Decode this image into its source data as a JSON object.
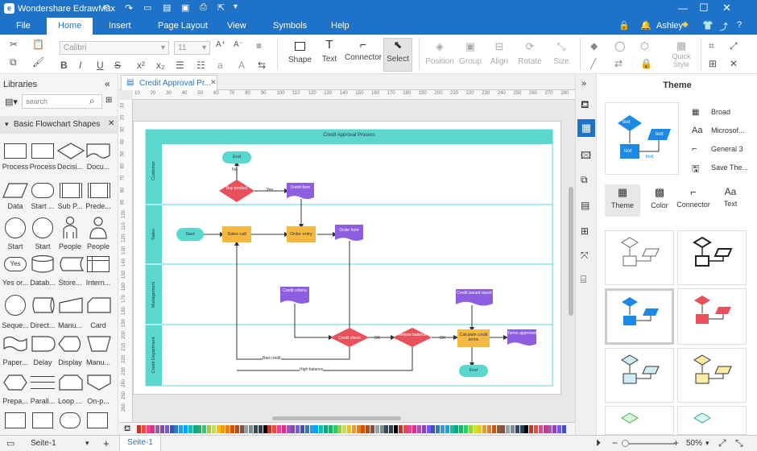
{
  "app": {
    "title": "Wondershare EdrawMax",
    "user": "Ashley"
  },
  "menu": [
    "File",
    "Home",
    "Insert",
    "Page Layout",
    "View",
    "Symbols",
    "Help"
  ],
  "ribbon": {
    "font": "Calibri",
    "size": "11",
    "tools": [
      "Shape",
      "Text",
      "Connector",
      "Select"
    ],
    "arrange": [
      "Position",
      "Group",
      "Align",
      "Rotate",
      "Size"
    ],
    "quick_style": "Quick Style"
  },
  "libraries": {
    "title": "Libraries",
    "search_placeholder": "search",
    "section": "Basic Flowchart Shapes",
    "shapes": [
      "Process",
      "Process",
      "Decisi...",
      "Docu...",
      "Data",
      "Start ...",
      "Sub P...",
      "Prede...",
      "Start",
      "Start",
      "People",
      "People",
      "Yes or...",
      "Datab...",
      "Store...",
      "Intern...",
      "Seque...",
      "Direct...",
      "Manu...",
      "Card",
      "Paper...",
      "Delay",
      "Display",
      "Manu...",
      "Prepa...",
      "Parall...",
      "Loop ...",
      "On-p..."
    ]
  },
  "doc_tab": "Credit Approval Pr...",
  "ruler": {
    "top": [
      "10",
      "20",
      "30",
      "40",
      "50",
      "60",
      "70",
      "80",
      "90",
      "100",
      "110",
      "120",
      "130",
      "140",
      "150",
      "160",
      "170",
      "180",
      "190",
      "200",
      "210",
      "220",
      "230",
      "240",
      "250",
      "260",
      "270",
      "280"
    ],
    "left": [
      "10",
      "20",
      "30",
      "40",
      "50",
      "60",
      "70",
      "80",
      "90",
      "100",
      "110",
      "120",
      "130",
      "140",
      "150",
      "160",
      "170",
      "180",
      "190",
      "200",
      "210",
      "220",
      "230",
      "240",
      "250",
      "260"
    ]
  },
  "diagram": {
    "title": "Credit Approval Process",
    "lanes": [
      "Customer",
      "Sales",
      "Management",
      "Credit Department"
    ],
    "nodes": {
      "end1": "End",
      "no": "No",
      "buy": "Buy product",
      "yes": "Yes",
      "cform": "Credit form",
      "start": "Start",
      "sales": "Sales call",
      "order": "Order entry",
      "oform": "Order form",
      "crit": "Credit criteria",
      "check": "Credit check",
      "ok1": "OK",
      "review": "Review balance",
      "ok2": "OK",
      "calc": "Calculate credit terms",
      "terms": "Terms approved",
      "report": "Credit issued report",
      "end2": "End",
      "bad": "Bad credit",
      "high": "High balance"
    }
  },
  "theme": {
    "title": "Theme",
    "preview": [
      "text",
      "text",
      "text",
      "text"
    ],
    "fonts": [
      "Broad",
      "Microsof...",
      "General 3",
      "Save The..."
    ],
    "tabs": [
      "Theme",
      "Color",
      "Connector",
      "Text"
    ]
  },
  "status": {
    "page": "Seite-1",
    "page_tab": "Seite-1",
    "zoom": "50%"
  }
}
